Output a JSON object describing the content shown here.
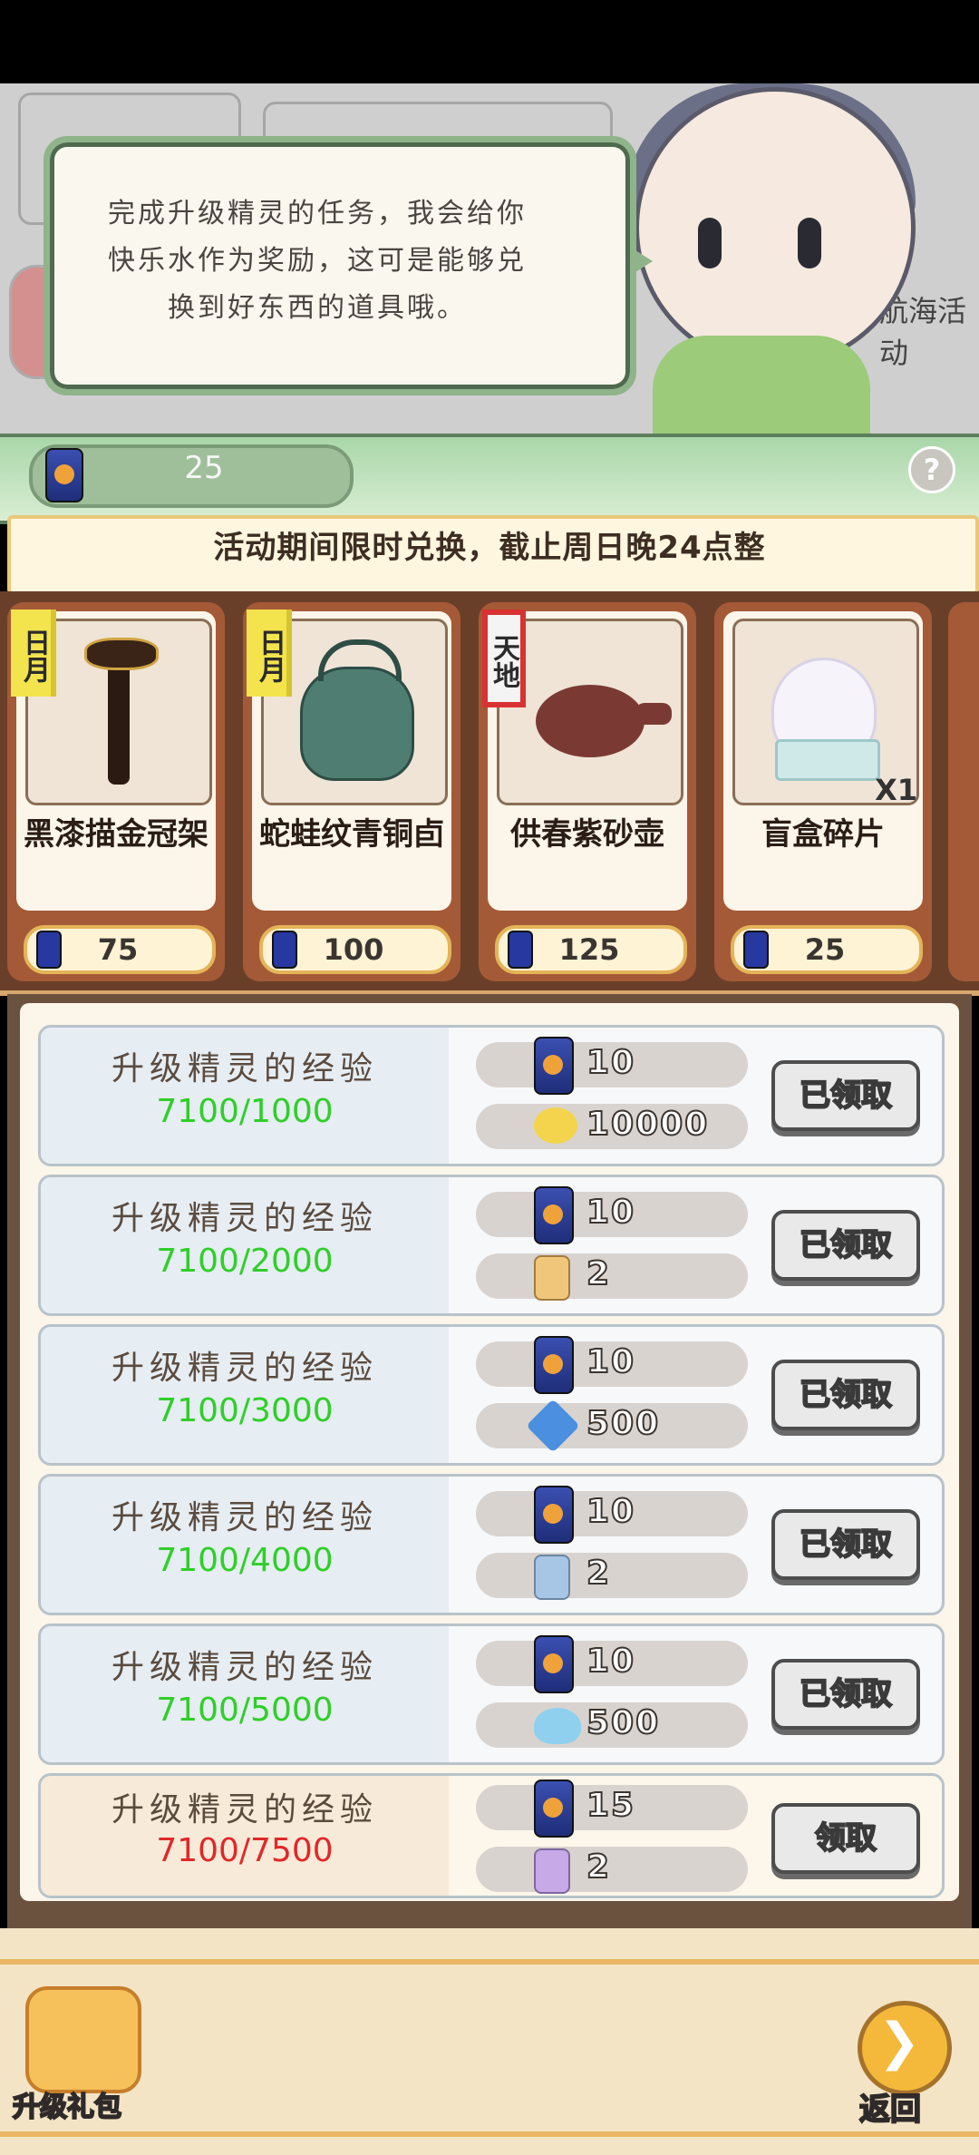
{
  "dialog": {
    "text_line1": "完成升级精灵的任务，我会给你",
    "text_line2": "快乐水作为奖励，这可是能够兑",
    "text_line3": "换到好东西的道具哦。"
  },
  "scene": {
    "event_label": "航海活动"
  },
  "currency": {
    "icon": "soda-can-icon",
    "count": "25"
  },
  "notice": "活动期间限时兑换，截止周日晚24点整",
  "shop_items": [
    {
      "tag": "日月",
      "tag_color": "#f3e44d",
      "name": "黑漆描金冠架",
      "price": "75"
    },
    {
      "tag": "日月",
      "tag_color": "#f3e44d",
      "name": "蛇蛙纹青铜卣",
      "price": "100"
    },
    {
      "tag": "天地",
      "tag_color": "#d83232",
      "name": "供春紫砂壶",
      "price": "125"
    },
    {
      "tag": "",
      "name": "盲盒碎片",
      "price": "25",
      "quantity": "X1"
    }
  ],
  "tasks": [
    {
      "title": "升级精灵的经验",
      "progress": "7100/1000",
      "reward1": {
        "icon": "soda-can-icon",
        "value": "10"
      },
      "reward2": {
        "icon": "flower-coin-icon",
        "value": "10000"
      },
      "button": "已领取"
    },
    {
      "title": "升级精灵的经验",
      "progress": "7100/2000",
      "reward1": {
        "icon": "soda-can-icon",
        "value": "10"
      },
      "reward2": {
        "icon": "food-bag-icon",
        "value": "2"
      },
      "button": "已领取"
    },
    {
      "title": "升级精灵的经验",
      "progress": "7100/3000",
      "reward1": {
        "icon": "soda-can-icon",
        "value": "10"
      },
      "reward2": {
        "icon": "diamond-icon",
        "value": "500"
      },
      "button": "已领取"
    },
    {
      "title": "升级精灵的经验",
      "progress": "7100/4000",
      "reward1": {
        "icon": "soda-can-icon",
        "value": "10"
      },
      "reward2": {
        "icon": "pet-food-bag-icon",
        "value": "2"
      },
      "button": "已领取"
    },
    {
      "title": "升级精灵的经验",
      "progress": "7100/5000",
      "reward1": {
        "icon": "soda-can-icon",
        "value": "10"
      },
      "reward2": {
        "icon": "slime-icon",
        "value": "500"
      },
      "button": "已领取"
    },
    {
      "title": "升级精灵的经验",
      "progress": "7100/7500",
      "reward1": {
        "icon": "soda-can-icon",
        "value": "15"
      },
      "reward2": {
        "icon": "purple-bag-icon",
        "value": "2"
      },
      "button": "领取"
    }
  ],
  "bottom": {
    "gift_label": "升级礼包",
    "back_label": "返回"
  },
  "colors": {
    "progress_done": "#2fcf28",
    "progress_pending": "#e02828"
  }
}
